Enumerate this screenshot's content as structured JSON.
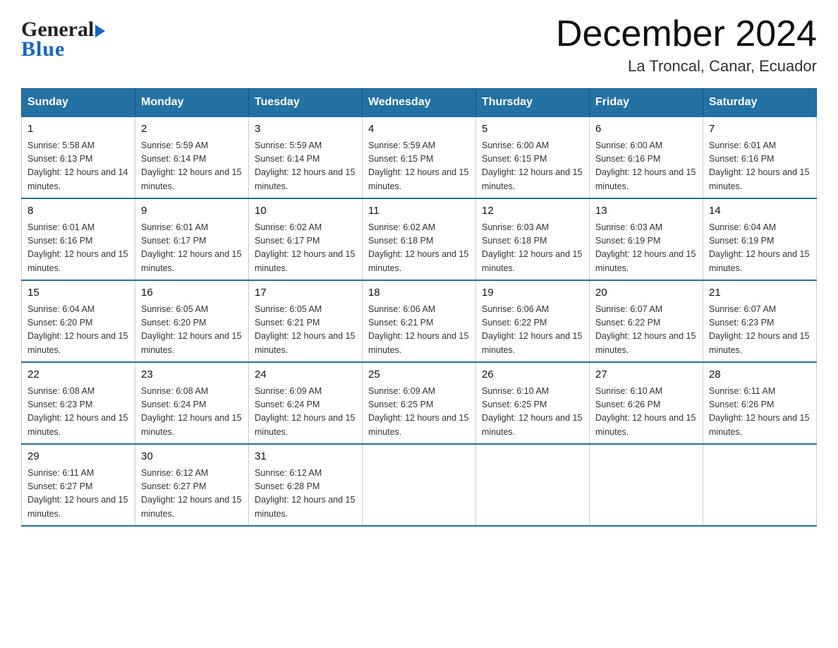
{
  "header": {
    "logo_general": "General",
    "logo_blue": "Blue",
    "month_title": "December 2024",
    "location": "La Troncal, Canar, Ecuador"
  },
  "days_of_week": [
    "Sunday",
    "Monday",
    "Tuesday",
    "Wednesday",
    "Thursday",
    "Friday",
    "Saturday"
  ],
  "weeks": [
    [
      {
        "day": "1",
        "sunrise": "Sunrise: 5:58 AM",
        "sunset": "Sunset: 6:13 PM",
        "daylight": "Daylight: 12 hours and 14 minutes."
      },
      {
        "day": "2",
        "sunrise": "Sunrise: 5:59 AM",
        "sunset": "Sunset: 6:14 PM",
        "daylight": "Daylight: 12 hours and 15 minutes."
      },
      {
        "day": "3",
        "sunrise": "Sunrise: 5:59 AM",
        "sunset": "Sunset: 6:14 PM",
        "daylight": "Daylight: 12 hours and 15 minutes."
      },
      {
        "day": "4",
        "sunrise": "Sunrise: 5:59 AM",
        "sunset": "Sunset: 6:15 PM",
        "daylight": "Daylight: 12 hours and 15 minutes."
      },
      {
        "day": "5",
        "sunrise": "Sunrise: 6:00 AM",
        "sunset": "Sunset: 6:15 PM",
        "daylight": "Daylight: 12 hours and 15 minutes."
      },
      {
        "day": "6",
        "sunrise": "Sunrise: 6:00 AM",
        "sunset": "Sunset: 6:16 PM",
        "daylight": "Daylight: 12 hours and 15 minutes."
      },
      {
        "day": "7",
        "sunrise": "Sunrise: 6:01 AM",
        "sunset": "Sunset: 6:16 PM",
        "daylight": "Daylight: 12 hours and 15 minutes."
      }
    ],
    [
      {
        "day": "8",
        "sunrise": "Sunrise: 6:01 AM",
        "sunset": "Sunset: 6:16 PM",
        "daylight": "Daylight: 12 hours and 15 minutes."
      },
      {
        "day": "9",
        "sunrise": "Sunrise: 6:01 AM",
        "sunset": "Sunset: 6:17 PM",
        "daylight": "Daylight: 12 hours and 15 minutes."
      },
      {
        "day": "10",
        "sunrise": "Sunrise: 6:02 AM",
        "sunset": "Sunset: 6:17 PM",
        "daylight": "Daylight: 12 hours and 15 minutes."
      },
      {
        "day": "11",
        "sunrise": "Sunrise: 6:02 AM",
        "sunset": "Sunset: 6:18 PM",
        "daylight": "Daylight: 12 hours and 15 minutes."
      },
      {
        "day": "12",
        "sunrise": "Sunrise: 6:03 AM",
        "sunset": "Sunset: 6:18 PM",
        "daylight": "Daylight: 12 hours and 15 minutes."
      },
      {
        "day": "13",
        "sunrise": "Sunrise: 6:03 AM",
        "sunset": "Sunset: 6:19 PM",
        "daylight": "Daylight: 12 hours and 15 minutes."
      },
      {
        "day": "14",
        "sunrise": "Sunrise: 6:04 AM",
        "sunset": "Sunset: 6:19 PM",
        "daylight": "Daylight: 12 hours and 15 minutes."
      }
    ],
    [
      {
        "day": "15",
        "sunrise": "Sunrise: 6:04 AM",
        "sunset": "Sunset: 6:20 PM",
        "daylight": "Daylight: 12 hours and 15 minutes."
      },
      {
        "day": "16",
        "sunrise": "Sunrise: 6:05 AM",
        "sunset": "Sunset: 6:20 PM",
        "daylight": "Daylight: 12 hours and 15 minutes."
      },
      {
        "day": "17",
        "sunrise": "Sunrise: 6:05 AM",
        "sunset": "Sunset: 6:21 PM",
        "daylight": "Daylight: 12 hours and 15 minutes."
      },
      {
        "day": "18",
        "sunrise": "Sunrise: 6:06 AM",
        "sunset": "Sunset: 6:21 PM",
        "daylight": "Daylight: 12 hours and 15 minutes."
      },
      {
        "day": "19",
        "sunrise": "Sunrise: 6:06 AM",
        "sunset": "Sunset: 6:22 PM",
        "daylight": "Daylight: 12 hours and 15 minutes."
      },
      {
        "day": "20",
        "sunrise": "Sunrise: 6:07 AM",
        "sunset": "Sunset: 6:22 PM",
        "daylight": "Daylight: 12 hours and 15 minutes."
      },
      {
        "day": "21",
        "sunrise": "Sunrise: 6:07 AM",
        "sunset": "Sunset: 6:23 PM",
        "daylight": "Daylight: 12 hours and 15 minutes."
      }
    ],
    [
      {
        "day": "22",
        "sunrise": "Sunrise: 6:08 AM",
        "sunset": "Sunset: 6:23 PM",
        "daylight": "Daylight: 12 hours and 15 minutes."
      },
      {
        "day": "23",
        "sunrise": "Sunrise: 6:08 AM",
        "sunset": "Sunset: 6:24 PM",
        "daylight": "Daylight: 12 hours and 15 minutes."
      },
      {
        "day": "24",
        "sunrise": "Sunrise: 6:09 AM",
        "sunset": "Sunset: 6:24 PM",
        "daylight": "Daylight: 12 hours and 15 minutes."
      },
      {
        "day": "25",
        "sunrise": "Sunrise: 6:09 AM",
        "sunset": "Sunset: 6:25 PM",
        "daylight": "Daylight: 12 hours and 15 minutes."
      },
      {
        "day": "26",
        "sunrise": "Sunrise: 6:10 AM",
        "sunset": "Sunset: 6:25 PM",
        "daylight": "Daylight: 12 hours and 15 minutes."
      },
      {
        "day": "27",
        "sunrise": "Sunrise: 6:10 AM",
        "sunset": "Sunset: 6:26 PM",
        "daylight": "Daylight: 12 hours and 15 minutes."
      },
      {
        "day": "28",
        "sunrise": "Sunrise: 6:11 AM",
        "sunset": "Sunset: 6:26 PM",
        "daylight": "Daylight: 12 hours and 15 minutes."
      }
    ],
    [
      {
        "day": "29",
        "sunrise": "Sunrise: 6:11 AM",
        "sunset": "Sunset: 6:27 PM",
        "daylight": "Daylight: 12 hours and 15 minutes."
      },
      {
        "day": "30",
        "sunrise": "Sunrise: 6:12 AM",
        "sunset": "Sunset: 6:27 PM",
        "daylight": "Daylight: 12 hours and 15 minutes."
      },
      {
        "day": "31",
        "sunrise": "Sunrise: 6:12 AM",
        "sunset": "Sunset: 6:28 PM",
        "daylight": "Daylight: 12 hours and 15 minutes."
      },
      null,
      null,
      null,
      null
    ]
  ]
}
